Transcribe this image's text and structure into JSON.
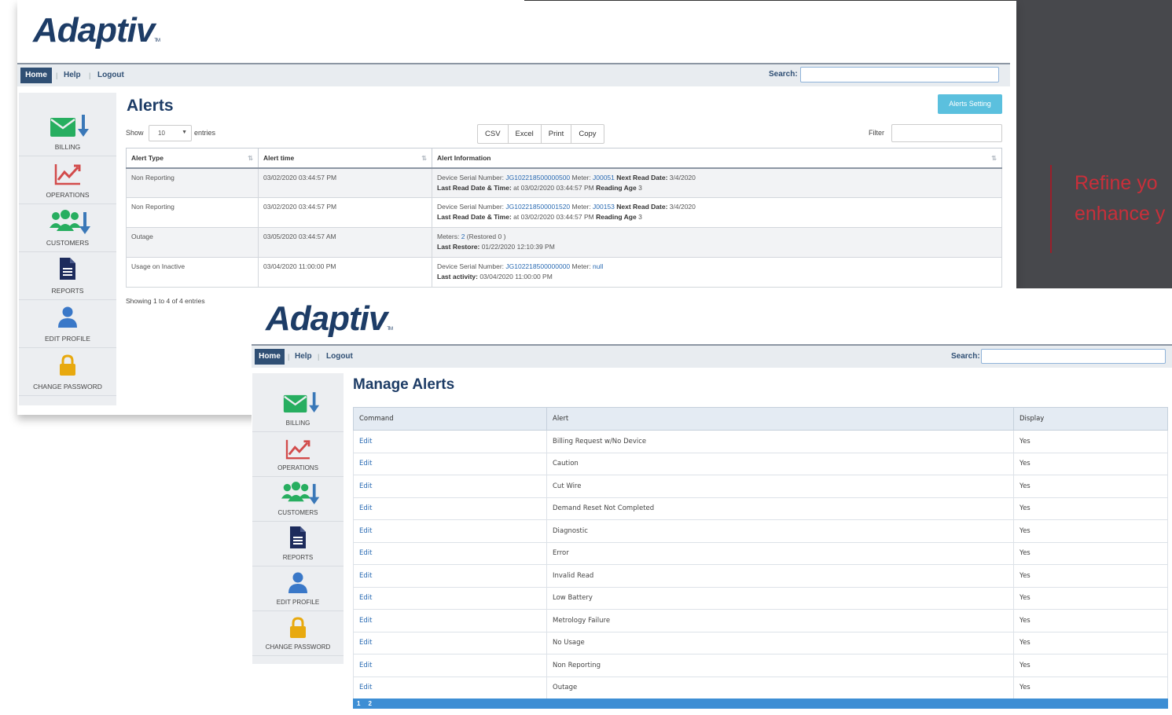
{
  "slide": {
    "refine_text": "Refine yo\nenhance y"
  },
  "win1": {
    "logo": "Adaptiv",
    "logo_tm": "TM",
    "nav": {
      "home": "Home",
      "help": "Help",
      "logout": "Logout",
      "sep": "|"
    },
    "search_label": "Search:",
    "sidebar": [
      {
        "label": "BILLING",
        "icon": "billing-icon"
      },
      {
        "label": "OPERATIONS",
        "icon": "operations-icon"
      },
      {
        "label": "CUSTOMERS",
        "icon": "customers-icon"
      },
      {
        "label": "REPORTS",
        "icon": "reports-icon"
      },
      {
        "label": "EDIT PROFILE",
        "icon": "user-icon"
      },
      {
        "label": "CHANGE PASSWORD",
        "icon": "lock-icon"
      }
    ],
    "title": "Alerts",
    "alerts_setting": "Alerts Setting",
    "show": "Show",
    "entries_value": "10",
    "entries": "entries",
    "export_buttons": [
      "CSV",
      "Excel",
      "Print",
      "Copy"
    ],
    "filter_label": "Filter",
    "columns": [
      "Alert Type",
      "Alert time",
      "Alert Information"
    ],
    "rows": [
      {
        "type": "Non Reporting",
        "time": "03/02/2020 03:44:57 PM",
        "l1a": "Device Serial Number: ",
        "l1b": "JG102218500000500",
        "l1c": " Meter: ",
        "l1d": "J00051",
        "l1e": " Next Read Date:",
        "l1f": " 3/4/2020",
        "l2a": "Last Read Date & Time:",
        "l2b": " at 03/02/2020 03:44:57 PM ",
        "l2c": "Reading Age",
        "l2d": " 3"
      },
      {
        "type": "Non Reporting",
        "time": "03/02/2020 03:44:57 PM",
        "l1a": "Device Serial Number: ",
        "l1b": "JG102218500001520",
        "l1c": " Meter: ",
        "l1d": "J00153",
        "l1e": " Next Read Date:",
        "l1f": " 3/4/2020",
        "l2a": "Last Read Date & Time:",
        "l2b": " at 03/02/2020 03:44:57 PM ",
        "l2c": "Reading Age",
        "l2d": " 3"
      },
      {
        "type": "Outage",
        "time": "03/05/2020 03:44:57 AM",
        "l1a": "Meters: ",
        "l1b": "2",
        "l1c": " (Restored 0 )",
        "l1d": "",
        "l1e": "",
        "l1f": "",
        "l2a": "Last Restore:",
        "l2b": " 01/22/2020 12:10:39 PM",
        "l2c": "",
        "l2d": ""
      },
      {
        "type": "Usage on Inactive",
        "time": "03/04/2020 11:00:00 PM",
        "l1a": "Device Serial Number: ",
        "l1b": "JG102218500000000",
        "l1c": " Meter: ",
        "l1d": "null",
        "l1e": "",
        "l1f": "",
        "l2a": "Last activity:",
        "l2b": " 03/04/2020 11:00:00 PM",
        "l2c": "",
        "l2d": ""
      }
    ],
    "showing": "Showing 1 to 4 of 4 entries"
  },
  "win2": {
    "logo": "Adaptiv",
    "logo_tm": "TM",
    "nav": {
      "home": "Home",
      "help": "Help",
      "logout": "Logout",
      "sep": "|"
    },
    "search_label": "Search:",
    "sidebar": [
      {
        "label": "BILLING",
        "icon": "billing-icon"
      },
      {
        "label": "OPERATIONS",
        "icon": "operations-icon"
      },
      {
        "label": "CUSTOMERS",
        "icon": "customers-icon"
      },
      {
        "label": "REPORTS",
        "icon": "reports-icon"
      },
      {
        "label": "EDIT PROFILE",
        "icon": "user-icon"
      },
      {
        "label": "CHANGE PASSWORD",
        "icon": "lock-icon"
      }
    ],
    "title": "Manage Alerts",
    "columns": [
      "Command",
      "Alert",
      "Display"
    ],
    "rows": [
      {
        "cmd": "Edit",
        "alert": "Billing Request w/No Device",
        "display": "Yes"
      },
      {
        "cmd": "Edit",
        "alert": "Caution",
        "display": "Yes"
      },
      {
        "cmd": "Edit",
        "alert": "Cut Wire",
        "display": "Yes"
      },
      {
        "cmd": "Edit",
        "alert": "Demand Reset Not Completed",
        "display": "Yes"
      },
      {
        "cmd": "Edit",
        "alert": "Diagnostic",
        "display": "Yes"
      },
      {
        "cmd": "Edit",
        "alert": "Error",
        "display": "Yes"
      },
      {
        "cmd": "Edit",
        "alert": "Invalid Read",
        "display": "Yes"
      },
      {
        "cmd": "Edit",
        "alert": "Low Battery",
        "display": "Yes"
      },
      {
        "cmd": "Edit",
        "alert": "Metrology Failure",
        "display": "Yes"
      },
      {
        "cmd": "Edit",
        "alert": "No Usage",
        "display": "Yes"
      },
      {
        "cmd": "Edit",
        "alert": "Non Reporting",
        "display": "Yes"
      },
      {
        "cmd": "Edit",
        "alert": "Outage",
        "display": "Yes"
      }
    ],
    "pages": [
      "1",
      "2"
    ]
  },
  "colors": {
    "brand_navy": "#1d3c66",
    "nav_home_bg": "#2f4f74",
    "link_blue": "#2a6bb3",
    "alerts_setting_bg": "#5bc0de",
    "slide_dark": "#47484c",
    "slide_red": "#c92f3a"
  }
}
